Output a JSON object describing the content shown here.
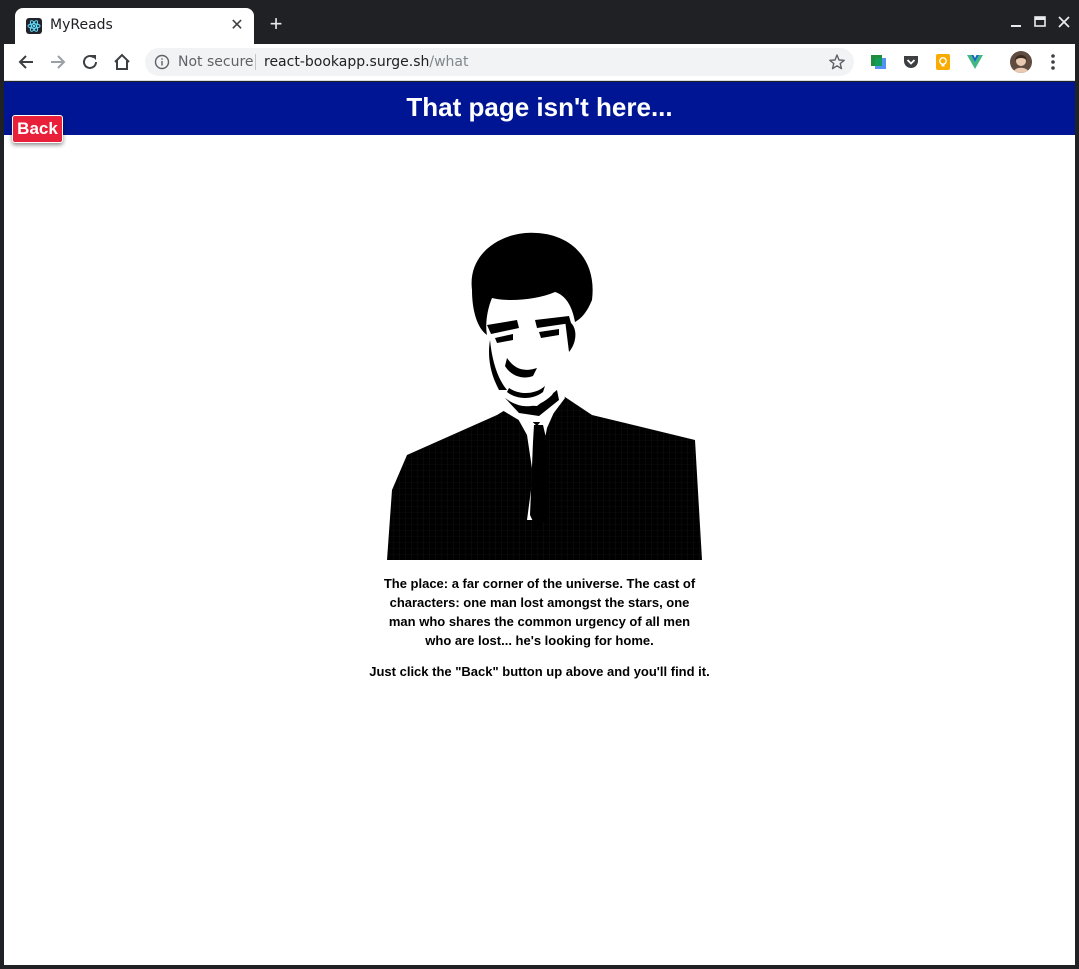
{
  "browser": {
    "tab_title": "MyReads",
    "tab_close": "✕",
    "new_tab": "+",
    "address": {
      "security_label": "Not secure",
      "host": "react-bookapp.surge.sh",
      "path": "/what"
    },
    "icons": [
      "react-favicon-icon",
      "back-arrow-icon",
      "forward-arrow-icon",
      "reload-icon",
      "home-icon",
      "info-icon",
      "star-icon",
      "extension-icon",
      "pocket-icon",
      "keep-icon",
      "vuejs-icon",
      "avatar",
      "menu-icon",
      "minimize-icon",
      "maximize-icon",
      "close-window-icon"
    ]
  },
  "page": {
    "header_title": "That page isn't here...",
    "back_label": "Back",
    "header_color": "#001593",
    "back_color": "#e8203a",
    "caption": "The place: a far corner of the universe. The cast of characters: one man lost amongst the stars, one man who shares the common urgency of all men who are lost... he's looking for home.",
    "instruction": "Just click the \"Back\" button up above and you'll find it."
  }
}
